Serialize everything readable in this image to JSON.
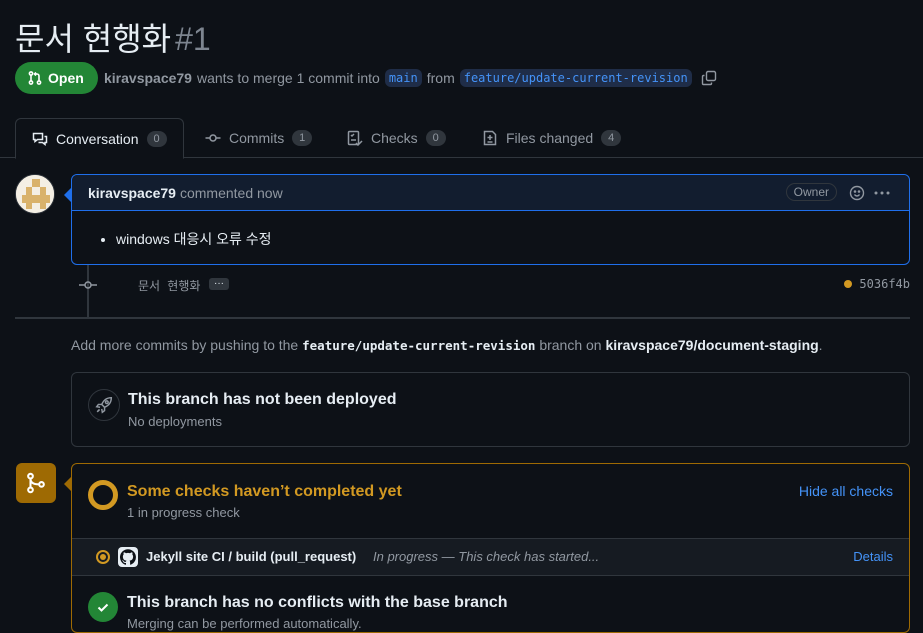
{
  "pr": {
    "title": "문서 현행화",
    "number": "#1",
    "state": "Open",
    "author": "kiravspace79",
    "merge_text_1": "wants to merge 1 commit into",
    "base_branch": "main",
    "from_text": "from",
    "head_branch": "feature/update-current-revision"
  },
  "tabs": [
    {
      "label": "Conversation",
      "count": "0"
    },
    {
      "label": "Commits",
      "count": "1"
    },
    {
      "label": "Checks",
      "count": "0"
    },
    {
      "label": "Files changed",
      "count": "4"
    }
  ],
  "comment": {
    "author": "kiravspace79",
    "time": "commented now",
    "badge": "Owner",
    "items": [
      "windows 대응시 오류 수정"
    ]
  },
  "commit": {
    "message": "문서 현행화",
    "ellipsis": "···",
    "sha": "5036f4b"
  },
  "add_more": {
    "prefix": "Add more commits by pushing to the",
    "branch": "feature/update-current-revision",
    "middle": "branch on",
    "repo": "kiravspace79/document-staging",
    "suffix": "."
  },
  "deploy": {
    "title": "This branch has not been deployed",
    "subtitle": "No deployments"
  },
  "checks": {
    "title": "Some checks haven’t completed yet",
    "subtitle": "1 in progress check",
    "hide_link": "Hide all checks",
    "row": {
      "name": "Jekyll site CI / build (pull_request)",
      "status": "In progress — This check has started...",
      "details": "Details"
    }
  },
  "conflicts": {
    "title": "This branch has no conflicts with the base branch",
    "subtitle": "Merging can be performed automatically."
  },
  "colors": {
    "open": "#238636",
    "link": "#4493f8",
    "pending": "#d29922"
  }
}
